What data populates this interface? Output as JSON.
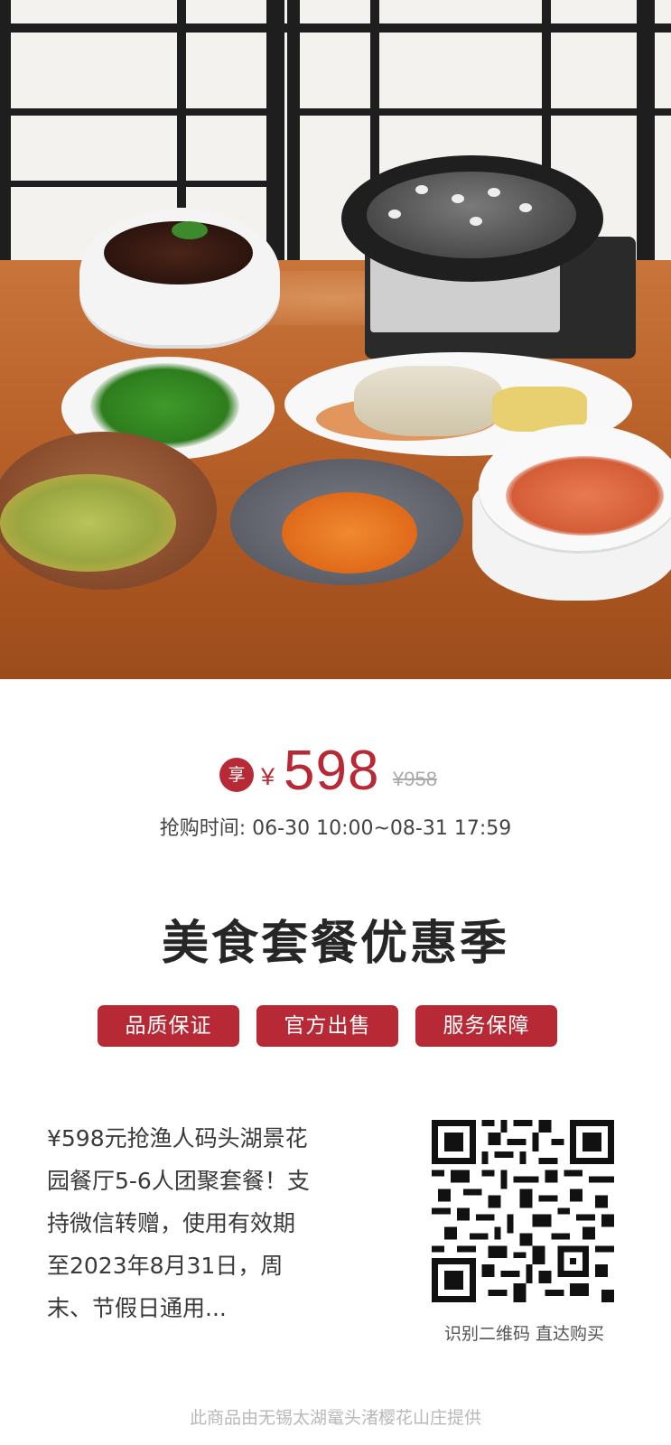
{
  "price": {
    "badge": "享",
    "currency": "¥",
    "amount": "598",
    "original": "¥958"
  },
  "sale_time": "抢购时间: 06-30 10:00~08-31 17:59",
  "headline": "美食套餐优惠季",
  "tags": [
    "品质保证",
    "官方出售",
    "服务保障"
  ],
  "description": {
    "line1": "¥598元抢渔人码头湖景花",
    "line2": "园餐厅5-6人团聚套餐！支",
    "line3": "持微信转赠，使用有效期",
    "line4": "至2023年8月31日，周",
    "line5": "末、节假日通用..."
  },
  "qr_caption": "识别二维码 直达购买",
  "footer": "此商品由无锡太湖鼋头渚樱花山庄提供",
  "colors": {
    "accent": "#b72a35",
    "text_dark": "#262626",
    "text_muted": "#aaaaaa"
  },
  "icons": {
    "qr": "qr-code-icon"
  }
}
